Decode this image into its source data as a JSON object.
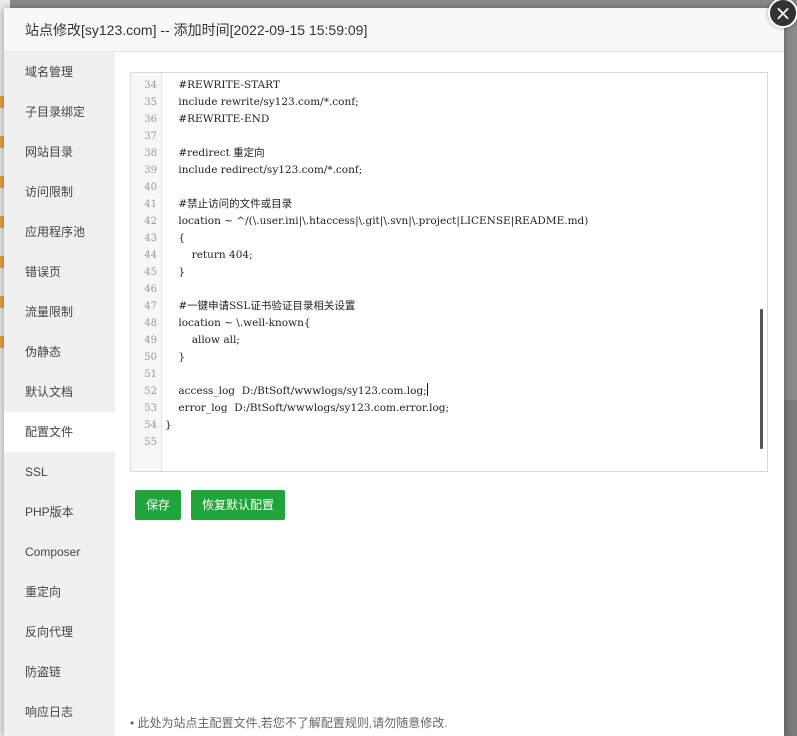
{
  "dialog": {
    "title": "站点修改[sy123.com] -- 添加时间[2022-09-15 15:59:09]",
    "close_glyph": "×"
  },
  "sidebar": {
    "items": [
      {
        "label": "域名管理"
      },
      {
        "label": "子目录绑定"
      },
      {
        "label": "网站目录"
      },
      {
        "label": "访问限制"
      },
      {
        "label": "应用程序池"
      },
      {
        "label": "错误页"
      },
      {
        "label": "流量限制"
      },
      {
        "label": "伪静态"
      },
      {
        "label": "默认文档"
      },
      {
        "label": "配置文件"
      },
      {
        "label": "SSL"
      },
      {
        "label": "PHP版本"
      },
      {
        "label": "Composer"
      },
      {
        "label": "重定向"
      },
      {
        "label": "反向代理"
      },
      {
        "label": "防盗链"
      },
      {
        "label": "响应日志"
      }
    ],
    "active_index": 9
  },
  "editor": {
    "lines": [
      {
        "n": "34",
        "text": "    #REWRITE-START"
      },
      {
        "n": "35",
        "text": "    include rewrite/sy123.com/*.conf;"
      },
      {
        "n": "36",
        "text": "    #REWRITE-END"
      },
      {
        "n": "37",
        "text": ""
      },
      {
        "n": "38",
        "text": "    #redirect 重定向"
      },
      {
        "n": "39",
        "text": "    include redirect/sy123.com/*.conf;"
      },
      {
        "n": "40",
        "text": ""
      },
      {
        "n": "41",
        "text": "    #禁止访问的文件或目录"
      },
      {
        "n": "42",
        "text": "    location ~ ^/(\\.user.ini|\\.htaccess|\\.git|\\.svn|\\.project|LICENSE|README.md)"
      },
      {
        "n": "43",
        "text": "    {"
      },
      {
        "n": "44",
        "text": "        return 404;"
      },
      {
        "n": "45",
        "text": "    }"
      },
      {
        "n": "46",
        "text": ""
      },
      {
        "n": "47",
        "text": "    #一键申请SSL证书验证目录相关设置"
      },
      {
        "n": "48",
        "text": "    location ~ \\.well-known{"
      },
      {
        "n": "49",
        "text": "        allow all;"
      },
      {
        "n": "50",
        "text": "    }"
      },
      {
        "n": "51",
        "text": ""
      },
      {
        "n": "52",
        "text": "    access_log  D:/BtSoft/wwwlogs/sy123.com.log;"
      },
      {
        "n": "53",
        "text": "    error_log  D:/BtSoft/wwwlogs/sy123.com.error.log;"
      },
      {
        "n": "54",
        "text": "}"
      },
      {
        "n": "55",
        "text": ""
      }
    ],
    "caret_line": "52"
  },
  "buttons": {
    "save": "保存",
    "restore": "恢复默认配置"
  },
  "tip": "此处为站点主配置文件,若您不了解配置规则,请勿随意修改.",
  "colors": {
    "accent": "#20a53a",
    "sidebar_bg": "#f0f0f0",
    "close_bg": "#333333"
  }
}
